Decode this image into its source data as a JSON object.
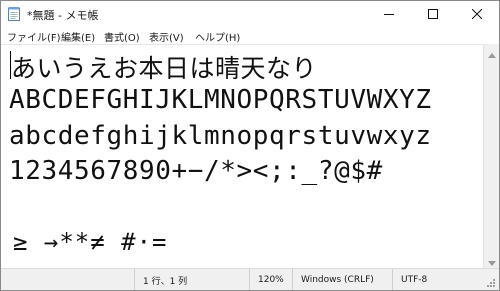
{
  "window": {
    "title": "*無題 - メモ帳",
    "icon": "notepad-icon"
  },
  "controls": {
    "minimize_icon": "minimize-icon",
    "maximize_icon": "maximize-icon",
    "close_icon": "close-icon"
  },
  "menu": {
    "items": [
      {
        "label": "ファイル(F)"
      },
      {
        "label": "編集(E)"
      },
      {
        "label": "書式(O)"
      },
      {
        "label": "表示(V)"
      },
      {
        "label": "ヘルプ(H)"
      }
    ]
  },
  "editor": {
    "lines": [
      "あいうえお本日は晴天なり",
      "ABCDEFGHIJKLMNOPQRSTUVWXYZ",
      "abcdefghijklmnopqrstuvwxyz",
      "1234567890+−/*><;:_?@$#",
      "",
      "≥ →**≠ #·="
    ]
  },
  "statusbar": {
    "position": "1 行、1 列",
    "zoom": "120%",
    "line_ending": "Windows (CRLF)",
    "encoding": "UTF-8"
  }
}
